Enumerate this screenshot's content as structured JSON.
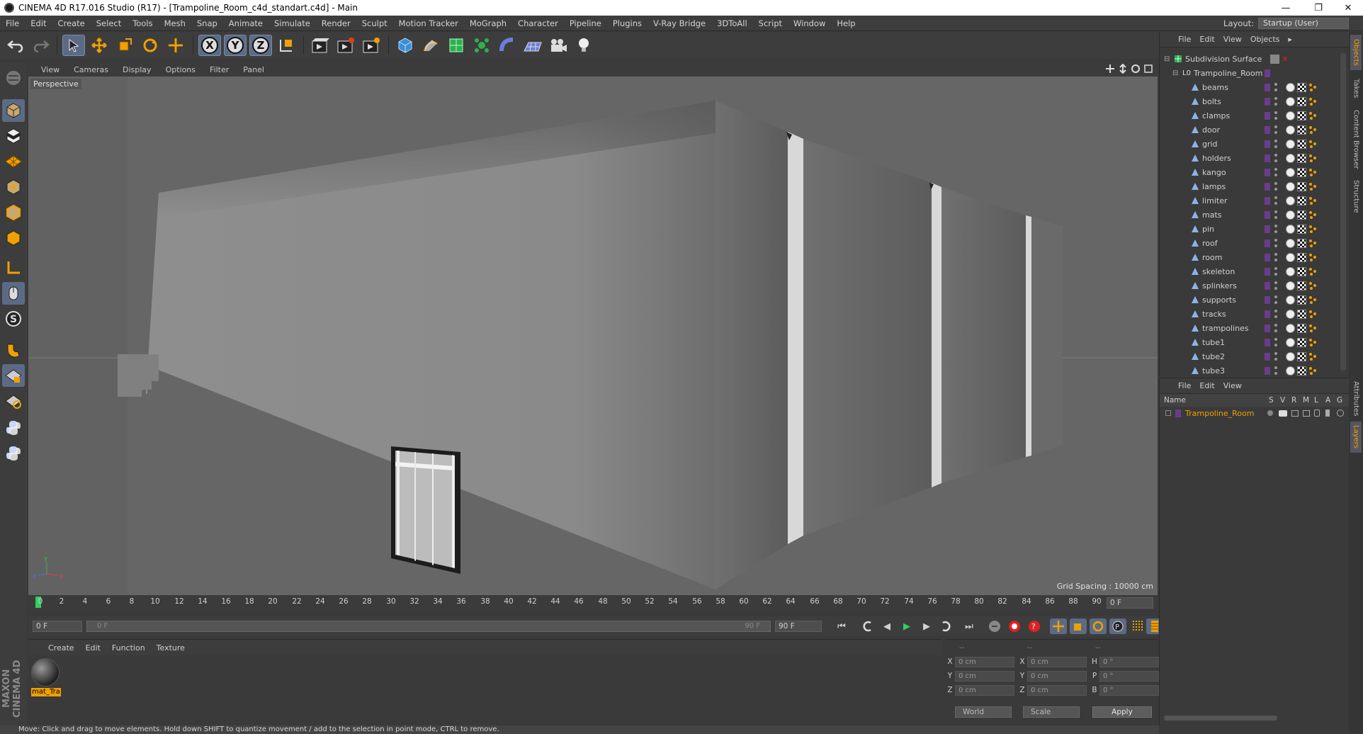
{
  "window": {
    "title": "CINEMA 4D R17.016 Studio (R17) - [Trampoline_Room_c4d_standart.c4d] - Main",
    "minimize": "—",
    "restore": "❐",
    "close": "✕"
  },
  "menubar": {
    "items": [
      "File",
      "Edit",
      "Create",
      "Select",
      "Tools",
      "Mesh",
      "Snap",
      "Animate",
      "Simulate",
      "Render",
      "Sculpt",
      "Motion Tracker",
      "MoGraph",
      "Character",
      "Pipeline",
      "Plugins",
      "V-Ray Bridge",
      "3DToAll",
      "Script",
      "Window",
      "Help"
    ],
    "layout_label": "Layout:",
    "layout_value": "Startup (User)"
  },
  "viewport": {
    "menu": [
      "View",
      "Cameras",
      "Display",
      "Options",
      "Filter",
      "Panel"
    ],
    "camera": "Perspective",
    "grid_spacing": "Grid Spacing : 10000 cm",
    "axis": {
      "y": "y",
      "z": "z",
      "x": "x"
    }
  },
  "timeline": {
    "ticks": [
      "0",
      "2",
      "4",
      "6",
      "8",
      "10",
      "12",
      "14",
      "16",
      "18",
      "20",
      "22",
      "24",
      "26",
      "28",
      "30",
      "32",
      "34",
      "36",
      "38",
      "40",
      "42",
      "44",
      "46",
      "48",
      "50",
      "52",
      "54",
      "56",
      "58",
      "60",
      "62",
      "64",
      "66",
      "68",
      "70",
      "72",
      "74",
      "76",
      "78",
      "80",
      "82",
      "84",
      "86",
      "88",
      "90"
    ],
    "current_frame": "0 F",
    "start_frame": "0 F",
    "range_start": "0 F",
    "range_end": "90 F",
    "end_frame": "90 F"
  },
  "materials": {
    "menu": [
      "Create",
      "Edit",
      "Function",
      "Texture"
    ],
    "items": [
      {
        "name": "mat_Tra"
      }
    ]
  },
  "coordinates": {
    "header": [
      "--",
      "--",
      "--"
    ],
    "rows": [
      {
        "a1": "X",
        "v1": "0 cm",
        "a2": "X",
        "v2": "0 cm",
        "a3": "H",
        "v3": "0 °"
      },
      {
        "a1": "Y",
        "v1": "0 cm",
        "a2": "Y",
        "v2": "0 cm",
        "a3": "P",
        "v3": "0 °"
      },
      {
        "a1": "Z",
        "v1": "0 cm",
        "a2": "Z",
        "v2": "0 cm",
        "a3": "B",
        "v3": "0 °"
      }
    ],
    "mode": "World",
    "scale": "Scale",
    "apply": "Apply"
  },
  "status": "Move: Click and drag to move elements. Hold down SHIFT to quantize movement / add to the selection in point mode, CTRL to remove.",
  "brand": "MAXON CINEMA 4D",
  "object_manager": {
    "menu": [
      "File",
      "Edit",
      "View",
      "Objects",
      "▸"
    ],
    "root": "Subdivision Surface",
    "group": "Trampoline_Room",
    "objects": [
      "beams",
      "bolts",
      "clamps",
      "door",
      "grid",
      "holders",
      "kango",
      "lamps",
      "limiter",
      "mats",
      "pin",
      "roof",
      "room",
      "skeleton",
      "splinkers",
      "supports",
      "tracks",
      "trampolines",
      "tube1",
      "tube2",
      "tube3"
    ]
  },
  "layer_manager": {
    "menu": [
      "File",
      "Edit",
      "View"
    ],
    "columns": [
      "Name",
      "S",
      "V",
      "R",
      "M",
      "L",
      "A",
      "G"
    ],
    "layers": [
      {
        "name": "Trampoline_Room"
      }
    ]
  },
  "side_tabs": [
    "Objects",
    "Takes",
    "Content Browser",
    "Structure",
    "Attributes",
    "Layers"
  ],
  "colors": {
    "accent": "#f0a000",
    "selected_tool": "#5c6b85",
    "layer_color": "#6a3c8a",
    "viewport_bg": "#666666"
  }
}
